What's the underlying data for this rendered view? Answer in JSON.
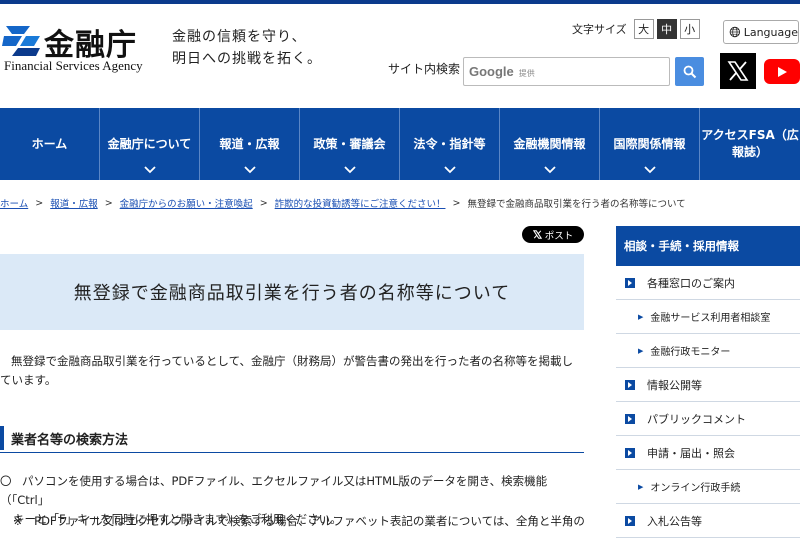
{
  "header": {
    "logo_jp": "金融庁",
    "logo_en": "Financial Services Agency",
    "tagline_line1": "金融の信頼を守り、",
    "tagline_line2": "明日への挑戦を拓く。",
    "font_size_label": "文字サイズ",
    "font_sizes": [
      "大",
      "中",
      "小"
    ],
    "font_size_selected": "中",
    "language_label": "Language",
    "search_label": "サイト内検索",
    "search_google": "Google",
    "search_sub": "提供"
  },
  "nav": {
    "items": [
      {
        "label": "ホーム",
        "has_chevron": false
      },
      {
        "label": "金融庁について",
        "has_chevron": true
      },
      {
        "label": "報道・広報",
        "has_chevron": true
      },
      {
        "label": "政策・審議会",
        "has_chevron": true
      },
      {
        "label": "法令・指針等",
        "has_chevron": true
      },
      {
        "label": "金融機関情報",
        "has_chevron": true
      },
      {
        "label": "国際関係情報",
        "has_chevron": true
      },
      {
        "label_line1": "アクセスFSA（広",
        "label_line2": "報誌）",
        "has_chevron": false
      }
    ]
  },
  "breadcrumb": {
    "items": [
      "ホーム",
      "報道・広報",
      "金融庁からのお願い・注意喚起",
      "詐欺的な投資勧誘等にご注意ください！"
    ],
    "current": "無登録で金融商品取引業を行う者の名称等について"
  },
  "post_button": "ポスト",
  "main": {
    "title": "無登録で金融商品取引業を行う者の名称等について",
    "intro_line1": "無登録で金融商品取引業を行っているとして、金融庁（財務局）が警告書の発出を行った者の名称等を掲載してい",
    "intro_line2": "ます。",
    "section_heading": "業者名等の検索方法",
    "bullet1_mark": "〇",
    "bullet1_line1": "パソコンを使用する場合は、PDFファイル、エクセルファイル又はHTML版のデータを開き、検索機能（「Ctrl」",
    "bullet1_line2": "キーと「F」キーを同時に押すと開きます）をご利用ください。",
    "bullet2": "※　PDFファイル又はエクセルファイルで検索する場合、アルファベット表記の業者については、全角と半角の両"
  },
  "sidebar": {
    "heading": "相談・手続・採用情報",
    "items": [
      {
        "label": "各種窓口のご案内",
        "type": "main"
      },
      {
        "label": "金融サービス利用者相談室",
        "type": "sub"
      },
      {
        "label": "金融行政モニター",
        "type": "sub"
      },
      {
        "label": "情報公開等",
        "type": "main"
      },
      {
        "label": "パブリックコメント",
        "type": "main"
      },
      {
        "label": "申請・届出・照会",
        "type": "main"
      },
      {
        "label": "オンライン行政手続",
        "type": "sub"
      },
      {
        "label": "入札公告等",
        "type": "main"
      }
    ]
  },
  "colors": {
    "brand_blue": "#0b4aa2",
    "title_bg": "#dbe9f7",
    "link": "#1a4fb3",
    "youtube_red": "#ff0000"
  }
}
